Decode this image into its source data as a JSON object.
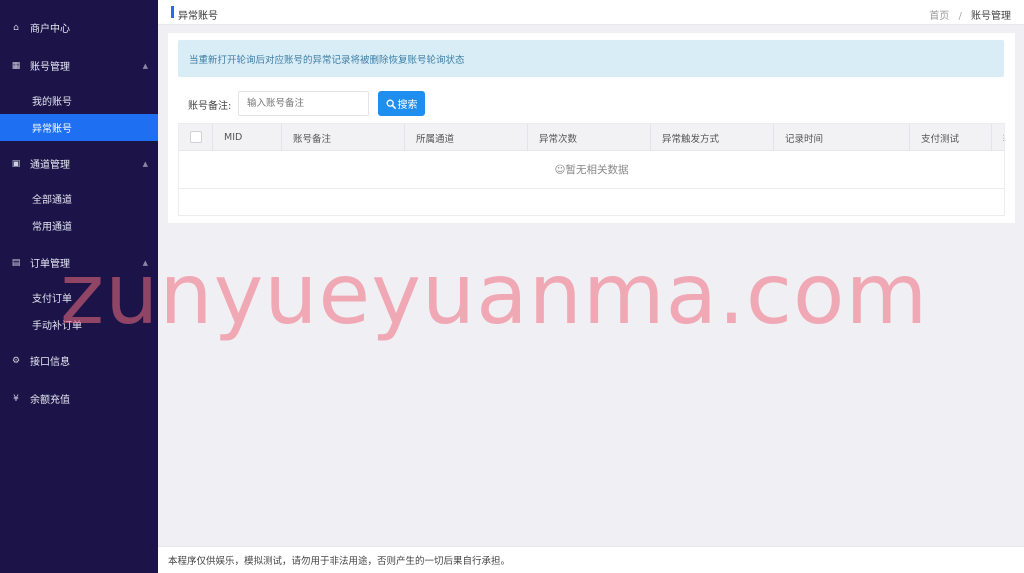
{
  "sidebar": {
    "items": [
      {
        "label": "商户中心",
        "icon": "home-icon"
      },
      {
        "label": "账号管理",
        "icon": "account-icon",
        "children": [
          "我的账号",
          "异常账号"
        ]
      },
      {
        "label": "通道管理",
        "icon": "channel-icon",
        "children": [
          "全部通道",
          "常用通道"
        ]
      },
      {
        "label": "订单管理",
        "icon": "order-icon",
        "children": [
          "支付订单",
          "手动补订单"
        ]
      },
      {
        "label": "接口信息",
        "icon": "gear-icon"
      },
      {
        "label": "余额充值",
        "icon": "yen-icon"
      }
    ],
    "active": "异常账号"
  },
  "header": {
    "title": "异常账号",
    "breadcrumb": [
      "首页",
      "/",
      "账号管理"
    ]
  },
  "main": {
    "alert": "当重新打开轮询后对应账号的异常记录将被删除恢复账号轮询状态",
    "search": {
      "label": "账号备注:",
      "placeholder": "输入账号备注",
      "button": "搜索"
    },
    "table": {
      "columns": [
        "MID",
        "账号备注",
        "所属通道",
        "异常次数",
        "异常触发方式",
        "记录时间",
        "支付测试",
        "轮"
      ],
      "empty_text": "☺暂无相关数据"
    }
  },
  "footer": {
    "text": "本程序仅供娱乐，模拟测试，请勿用于非法用途，否则产生的一切后果自行承担。"
  },
  "watermark": "zunyueyuanma.com",
  "colors": {
    "sidebar_bg": "#1c1448",
    "accent": "#1e6ff2",
    "alert_bg": "#d9edf6",
    "watermark": "#f06e82"
  }
}
